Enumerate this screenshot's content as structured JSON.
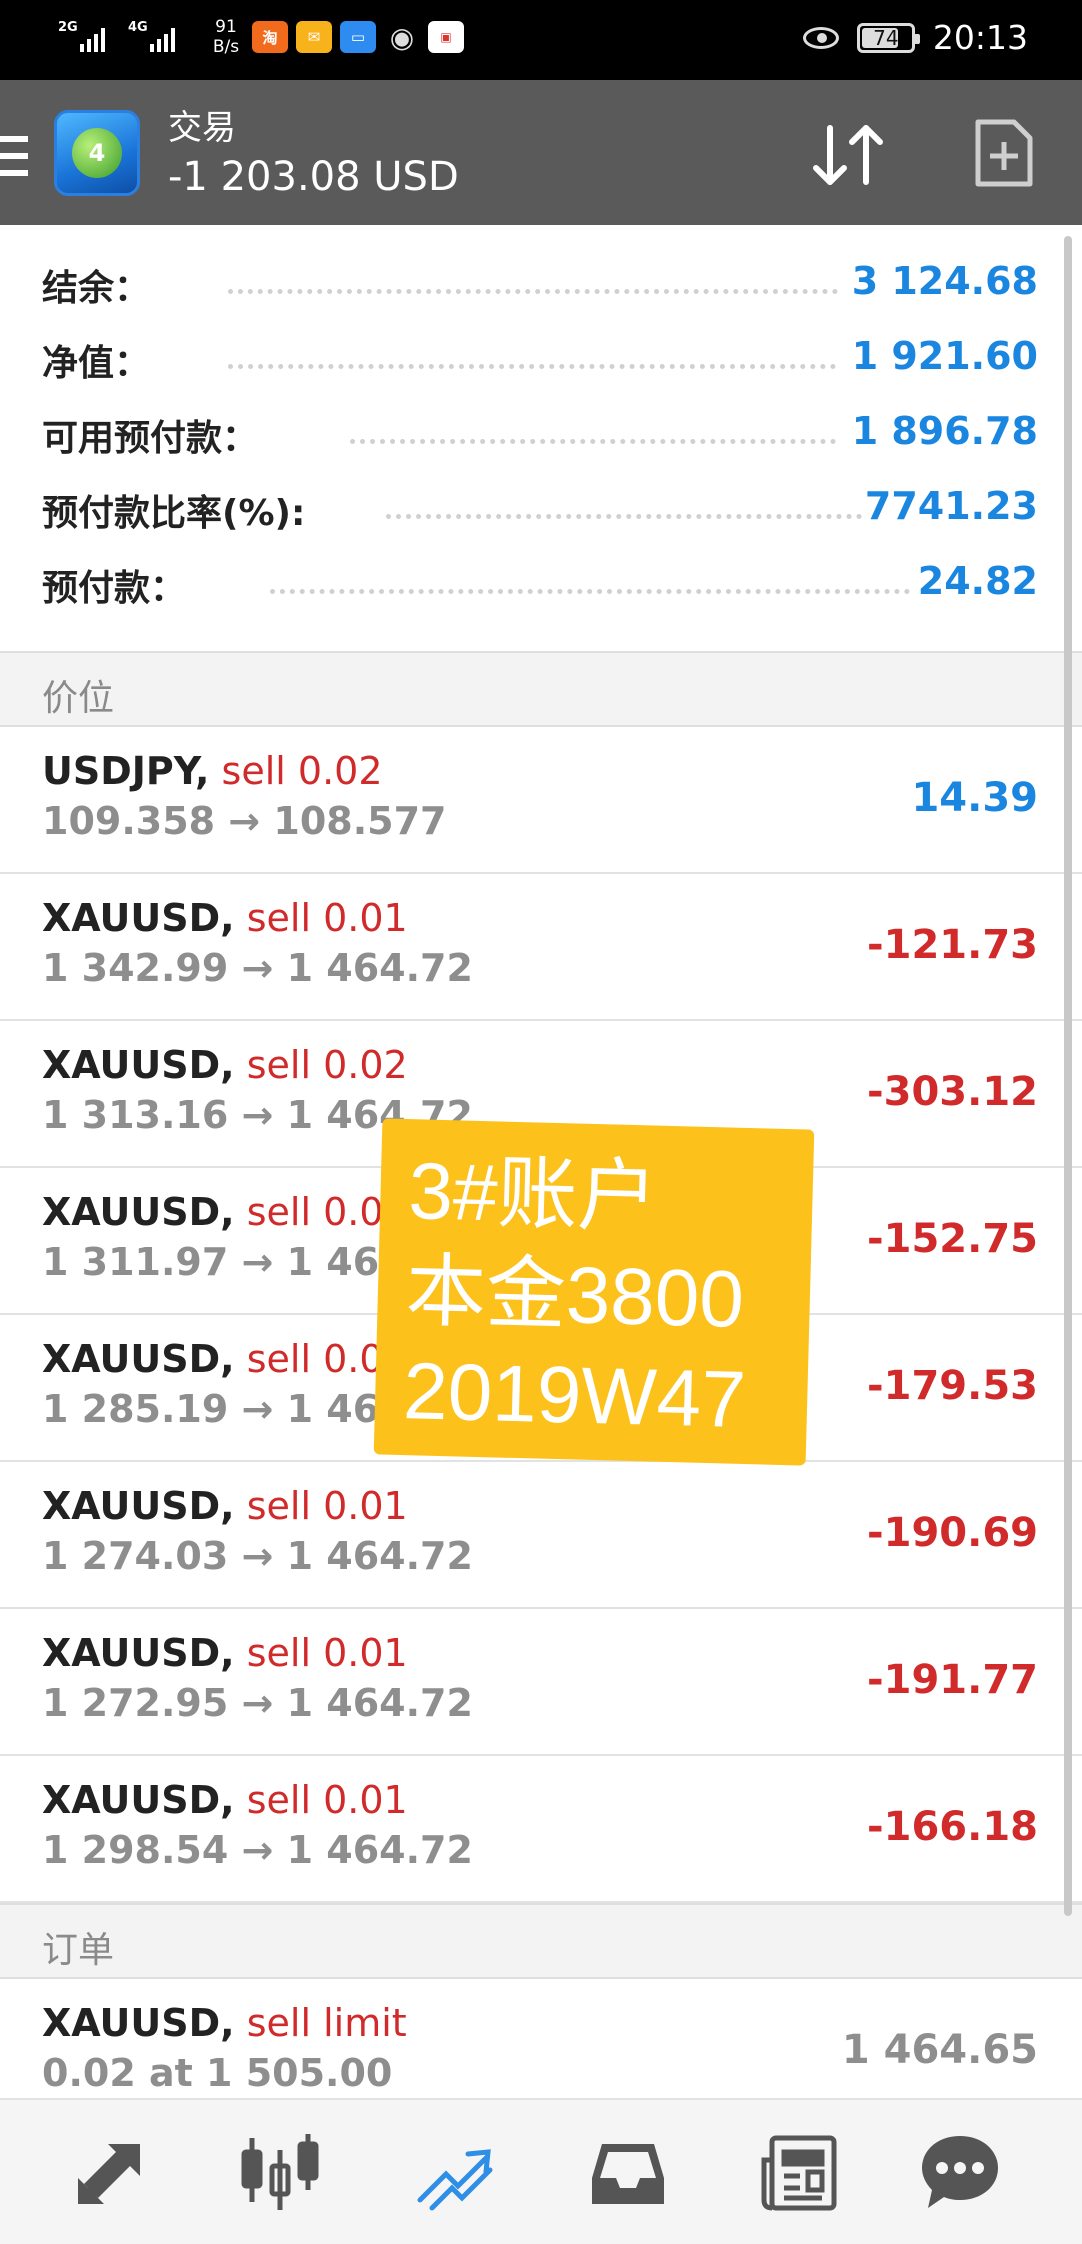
{
  "status_bar": {
    "sim1": "2G",
    "sim2": "4G",
    "speed_value": "91",
    "speed_unit": "B/s",
    "battery": "74",
    "time": "20:13"
  },
  "header": {
    "title": "交易",
    "balance": "-1 203.08 USD"
  },
  "summary": [
    {
      "label": "结余：",
      "value": "3 124.68"
    },
    {
      "label": "净值：",
      "value": "1 921.60"
    },
    {
      "label": "可用预付款：",
      "value": "1 896.78"
    },
    {
      "label": "预付款比率(%):",
      "value": "7741.23"
    },
    {
      "label": "预付款：",
      "value": "24.82"
    }
  ],
  "positions_header": "价位",
  "positions": [
    {
      "symbol": "USDJPY,",
      "side": "sell 0.02",
      "prices": "109.358 → 108.577",
      "pl": "14.39"
    },
    {
      "symbol": "XAUUSD,",
      "side": "sell 0.01",
      "prices": "1 342.99 → 1 464.72",
      "pl": "-121.73"
    },
    {
      "symbol": "XAUUSD,",
      "side": "sell 0.02",
      "prices": "1 313.16 → 1 464.72",
      "pl": "-303.12"
    },
    {
      "symbol": "XAUUSD,",
      "side": "sell 0.01",
      "prices": "1 311.97 → 1 464.72",
      "pl": "-152.75"
    },
    {
      "symbol": "XAUUSD,",
      "side": "sell 0.01",
      "prices": "1 285.19 → 1 464.72",
      "pl": "-179.53"
    },
    {
      "symbol": "XAUUSD,",
      "side": "sell 0.01",
      "prices": "1 274.03 → 1 464.72",
      "pl": "-190.69"
    },
    {
      "symbol": "XAUUSD,",
      "side": "sell 0.01",
      "prices": "1 272.95 → 1 464.72",
      "pl": "-191.77"
    },
    {
      "symbol": "XAUUSD,",
      "side": "sell 0.01",
      "prices": "1 298.54 → 1 464.72",
      "pl": "-166.18"
    }
  ],
  "orders_header": "订单",
  "orders": [
    {
      "symbol": "XAUUSD,",
      "side": "sell limit",
      "detail": "0.02 at 1 505.00",
      "price": "1 464.65"
    }
  ],
  "watermark": {
    "line1": "3#账户",
    "line2": "本金3800",
    "line3": "2019W47"
  },
  "colors": {
    "positive": "#1a86e0",
    "negative": "#d12a2a",
    "header_bg": "#5a5a5a",
    "watermark_bg": "#fcc21b"
  },
  "nav_icons": [
    "quotes-icon",
    "chart-icon",
    "trade-icon",
    "history-icon",
    "news-icon",
    "messages-icon"
  ],
  "nav_active": "trade-icon"
}
